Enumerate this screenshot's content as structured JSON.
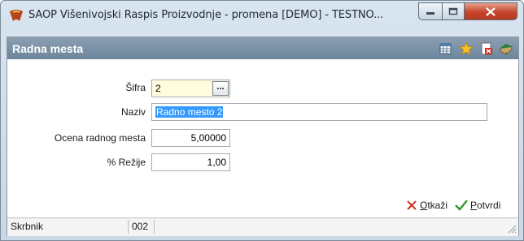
{
  "window": {
    "title": "SAOP Višenivojski Raspis Proizvodnje - promena [DEMO] - TESTNO...",
    "controls": {
      "minimize": "minimize",
      "maximize": "maximize",
      "close": "close"
    }
  },
  "panel": {
    "title": "Radna mesta",
    "toolbar_icons": [
      "table-icon",
      "star-icon",
      "delete-icon",
      "book-icon"
    ]
  },
  "form": {
    "sifra": {
      "label": "Šifra",
      "value": "2",
      "lookup_label": "..."
    },
    "naziv": {
      "label": "Naziv",
      "value": "Radno mesto 2"
    },
    "ocena": {
      "label": "Ocena radnog mesta",
      "value": "5,00000"
    },
    "rezije": {
      "label": "% Režije",
      "value": "1,00"
    }
  },
  "actions": {
    "cancel": {
      "underlined": "O",
      "rest": "tkaži"
    },
    "confirm": {
      "underlined": "P",
      "rest": "otvrdi"
    }
  },
  "statusbar": {
    "user_label": "Skrbnik",
    "code": "002"
  },
  "colors": {
    "header": "#7a90a5",
    "sifra_field": "#fffbdd",
    "selection": "#3399ff",
    "close_button": "#c5442b"
  }
}
